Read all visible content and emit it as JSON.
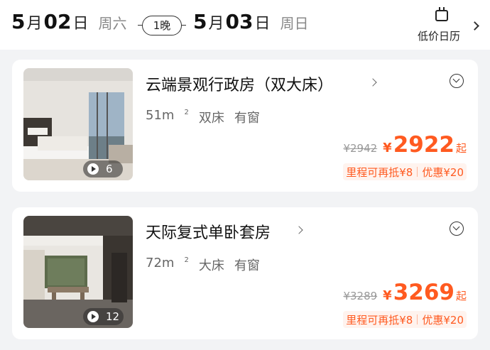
{
  "header": {
    "checkin": {
      "month": "5",
      "month_unit": "月",
      "day": "02",
      "day_unit": "日",
      "weekday": "周六"
    },
    "nights": "1晚",
    "checkout": {
      "month": "5",
      "month_unit": "月",
      "day": "03",
      "day_unit": "日",
      "weekday": "周日"
    },
    "calendar_label": "低价日历",
    "calendar_icon": "calendar-icon"
  },
  "rooms": [
    {
      "name": "云端景观行政房（双大床）",
      "area_value": "51m",
      "area_sup": "2",
      "bed": "双床",
      "window": "有窗",
      "photo_count": "6",
      "original_price": "¥2942",
      "currency": "¥",
      "price": "2922",
      "price_suffix": "起",
      "promo_miles": "里程可再抵¥8",
      "promo_discount": "优惠¥20"
    },
    {
      "name": "天际复式单卧套房",
      "area_value": "72m",
      "area_sup": "2",
      "bed": "大床",
      "window": "有窗",
      "photo_count": "12",
      "original_price": "¥3289",
      "currency": "¥",
      "price": "3269",
      "price_suffix": "起",
      "promo_miles": "里程可再抵¥8",
      "promo_discount": "优惠¥20"
    }
  ],
  "colors": {
    "accent": "#ff5a20",
    "promo_bg": "#fff3ee",
    "page_bg": "#f2f3f5"
  }
}
